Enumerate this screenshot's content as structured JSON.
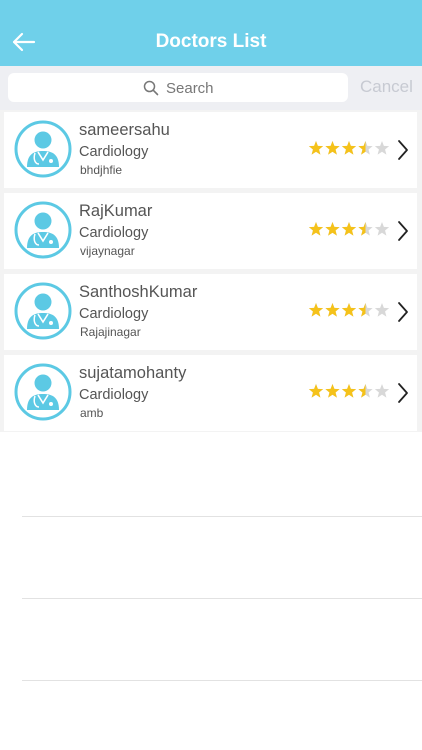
{
  "header": {
    "title": "Doctors List"
  },
  "search": {
    "placeholder": "Search",
    "cancel_label": "Cancel"
  },
  "doctors": [
    {
      "name": "sameersahu",
      "specialty": "Cardiology",
      "location": "bhdjhfie",
      "rating": 3.5
    },
    {
      "name": "RajKumar",
      "specialty": "Cardiology",
      "location": "vijaynagar",
      "rating": 3.5
    },
    {
      "name": "SanthoshKumar",
      "specialty": "Cardiology",
      "location": "Rajajinagar",
      "rating": 3.5
    },
    {
      "name": "sujatamohanty",
      "specialty": "Cardiology",
      "location": "amb",
      "rating": 3.5
    }
  ],
  "colors": {
    "accent": "#6fd0ea",
    "star": "#f5c21a",
    "star_empty": "#d8d8d8"
  },
  "icons": {
    "back": "arrow-left-icon",
    "search": "search-icon",
    "avatar": "doctor-avatar-icon",
    "star": "star-icon",
    "chevron": "chevron-right-icon"
  }
}
